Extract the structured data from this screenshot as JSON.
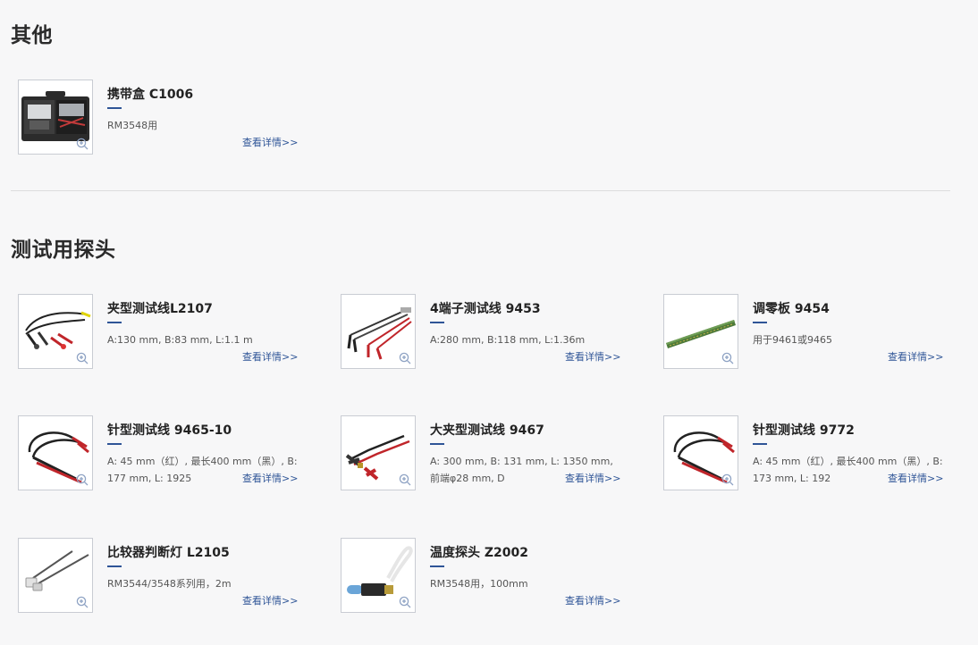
{
  "sections": [
    {
      "title": "其他",
      "products": [
        {
          "name": "携带盒 C1006",
          "desc": "RM3548用",
          "more": "查看详情>>",
          "image": "carrying-case"
        }
      ]
    },
    {
      "title": "测试用探头",
      "products": [
        {
          "name": "夹型测试线L2107",
          "desc": "A:130 mm, B:83 mm, L:1.1 m",
          "more": "查看详情>>",
          "image": "clip-test-lead"
        },
        {
          "name": "4端子测试线 9453",
          "desc": "A:280 mm, B:118 mm, L:1.36m",
          "more": "查看详情>>",
          "image": "four-terminal-lead"
        },
        {
          "name": "调零板 9454",
          "desc": "用于9461或9465",
          "more": "查看详情>>",
          "image": "zero-adjust-board"
        },
        {
          "name": "针型测试线 9465-10",
          "desc": "A: 45 mm（红）, 最长400 mm（黑）, B: 177 mm, L: 1925",
          "more": "查看详情>>",
          "image": "pin-type-lead"
        },
        {
          "name": "大夹型测试线 9467",
          "desc": "A: 300 mm, B: 131 mm, L: 1350 mm, 前端φ28 mm, D",
          "more": "查看详情>>",
          "image": "large-clip-lead"
        },
        {
          "name": "针型测试线 9772",
          "desc": "A: 45 mm（红）, 最长400 mm（黑）, B: 173 mm, L: 192",
          "more": "查看详情>>",
          "image": "pin-type-lead"
        },
        {
          "name": "比较器判断灯 L2105",
          "desc": "RM3544/3548系列用，2m",
          "more": "查看详情>>",
          "image": "comparator-lamp"
        },
        {
          "name": "温度探头 Z2002",
          "desc": "RM3548用，100mm",
          "more": "查看详情>>",
          "image": "temperature-probe"
        }
      ]
    }
  ],
  "colors": {
    "accent": "#2f5597",
    "background": "#f7f7f8",
    "title": "#2a2a2a"
  }
}
